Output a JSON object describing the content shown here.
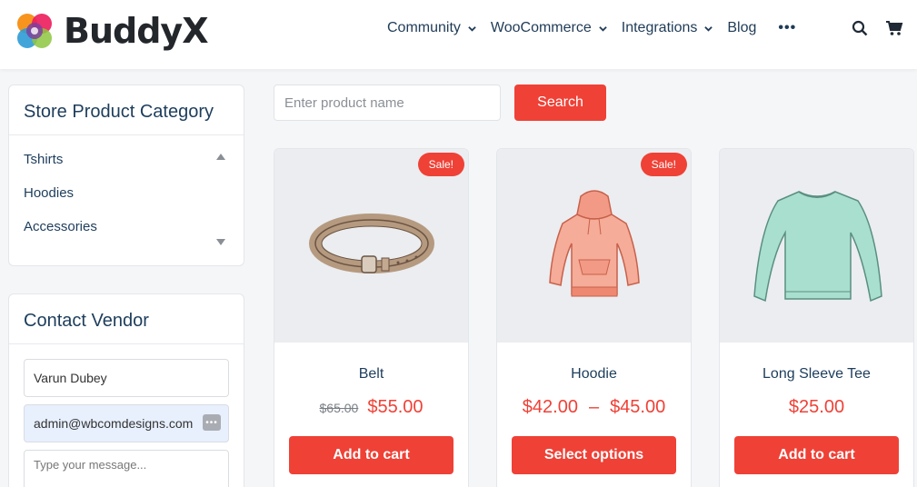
{
  "header": {
    "logo_text": "BuddyX",
    "nav": [
      {
        "label": "Community"
      },
      {
        "label": "WooCommerce"
      },
      {
        "label": "Integrations"
      },
      {
        "label": "Blog"
      }
    ],
    "more_label": "•••",
    "icons": [
      "search-icon",
      "cart-icon"
    ]
  },
  "sidebar": {
    "category_widget": {
      "title": "Store Product Category",
      "items": [
        "Tshirts",
        "Hoodies",
        "Accessories"
      ]
    },
    "contact_widget": {
      "title": "Contact Vendor",
      "name_value": "Varun Dubey",
      "email_value": "admin@wbcomdesigns.com",
      "message_placeholder": "Type your message..."
    }
  },
  "search": {
    "placeholder": "Enter product name",
    "button_label": "Search"
  },
  "products": [
    {
      "name": "Belt",
      "sale_badge": "Sale!",
      "old_price": "$65.00",
      "price": "$55.00",
      "button": "Add to cart"
    },
    {
      "name": "Hoodie",
      "sale_badge": "Sale!",
      "price_min": "$42.00",
      "price_sep": "–",
      "price_max": "$45.00",
      "button": "Select options"
    },
    {
      "name": "Long Sleeve Tee",
      "price": "$25.00",
      "button": "Add to cart"
    }
  ],
  "colors": {
    "accent": "#ef4136",
    "text": "#1d3d5c",
    "background": "#f5f6f8"
  }
}
